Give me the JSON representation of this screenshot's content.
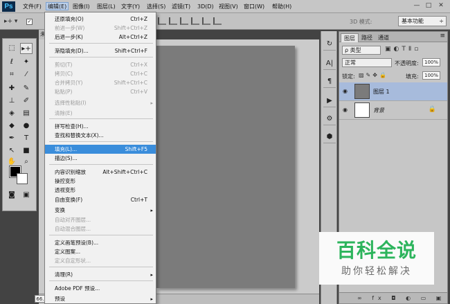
{
  "app": {
    "logo": "Ps"
  },
  "menubar": {
    "items": [
      "文件(F)",
      "编辑(E)",
      "图像(I)",
      "图层(L)",
      "文字(Y)",
      "选择(S)",
      "滤镜(T)",
      "3D(D)",
      "视图(V)",
      "窗口(W)",
      "帮助(H)"
    ],
    "window_controls": [
      "—",
      "□",
      "✕"
    ]
  },
  "options_bar": {
    "mode_label": "3D 模式:",
    "workspace": "基本功能"
  },
  "doc": {
    "tab_label": "未",
    "zoom": "66."
  },
  "edit_menu": {
    "items": [
      {
        "label": "还原填充(O)",
        "shortcut": "Ctrl+Z",
        "disabled": false
      },
      {
        "label": "前进一步(W)",
        "shortcut": "Shift+Ctrl+Z",
        "disabled": true
      },
      {
        "label": "后退一步(K)",
        "shortcut": "Alt+Ctrl+Z",
        "disabled": false
      },
      {
        "label": "渐隐填充(D)...",
        "shortcut": "Shift+Ctrl+F",
        "disabled": false
      },
      {
        "label": "剪切(T)",
        "shortcut": "Ctrl+X",
        "disabled": true
      },
      {
        "label": "拷贝(C)",
        "shortcut": "Ctrl+C",
        "disabled": true
      },
      {
        "label": "合并拷贝(Y)",
        "shortcut": "Shift+Ctrl+C",
        "disabled": true
      },
      {
        "label": "粘贴(P)",
        "shortcut": "Ctrl+V",
        "disabled": true
      },
      {
        "label": "选择性粘贴(I)",
        "shortcut": "",
        "disabled": true,
        "submenu": true
      },
      {
        "label": "清除(E)",
        "shortcut": "",
        "disabled": true
      },
      {
        "label": "拼写检查(H)...",
        "shortcut": "",
        "disabled": false
      },
      {
        "label": "查找和替换文本(X)...",
        "shortcut": "",
        "disabled": false
      },
      {
        "label": "填充(L)...",
        "shortcut": "Shift+F5",
        "disabled": false,
        "highlight": true
      },
      {
        "label": "描边(S)...",
        "shortcut": "",
        "disabled": false
      },
      {
        "label": "内容识别缩放",
        "shortcut": "Alt+Shift+Ctrl+C",
        "disabled": false
      },
      {
        "label": "操控变形",
        "shortcut": "",
        "disabled": false
      },
      {
        "label": "透视变形",
        "shortcut": "",
        "disabled": false
      },
      {
        "label": "自由变换(F)",
        "shortcut": "Ctrl+T",
        "disabled": false
      },
      {
        "label": "变换",
        "shortcut": "",
        "disabled": false,
        "submenu": true
      },
      {
        "label": "自动对齐图层...",
        "shortcut": "",
        "disabled": true
      },
      {
        "label": "自动混合图层...",
        "shortcut": "",
        "disabled": true
      },
      {
        "label": "定义画笔预设(B)...",
        "shortcut": "",
        "disabled": false
      },
      {
        "label": "定义图案...",
        "shortcut": "",
        "disabled": false
      },
      {
        "label": "定义自定形状...",
        "shortcut": "",
        "disabled": true
      },
      {
        "label": "清理(R)",
        "shortcut": "",
        "disabled": false,
        "submenu": true
      },
      {
        "label": "Adobe PDF 预设...",
        "shortcut": "",
        "disabled": false
      },
      {
        "label": "预设",
        "shortcut": "",
        "disabled": false,
        "submenu": true
      }
    ]
  },
  "layers_panel": {
    "tabs": [
      "图层",
      "路径",
      "通道"
    ],
    "kind": "ρ 类型",
    "blend_mode": "正常",
    "opacity_label": "不透明度:",
    "opacity": "100%",
    "lock_label": "锁定:",
    "fill_label": "填充:",
    "fill": "100%",
    "layers": [
      {
        "name": "图层 1",
        "thumb_color": "#7b7b7b",
        "selected": true,
        "locked": false
      },
      {
        "name": "背景",
        "thumb_color": "#ffffff",
        "selected": false,
        "locked": true
      }
    ]
  },
  "watermark": {
    "title": "百科全说",
    "subtitle": "助你轻松解决"
  }
}
